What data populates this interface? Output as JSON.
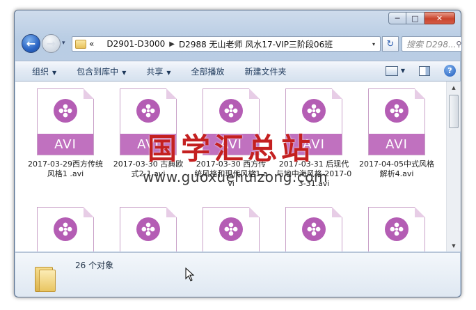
{
  "titlebar": {
    "minimize_glyph": "─",
    "maximize_glyph": "□",
    "close_glyph": "✕"
  },
  "nav": {
    "back_glyph": "←",
    "forward_glyph": "→",
    "history_glyph": "▾"
  },
  "address": {
    "overflow": "«",
    "crumbs": [
      "D2901-D3000",
      "D2988 无山老师 风水17-VIP三阶段06班"
    ],
    "separator": "▶",
    "dropdown_glyph": "▾",
    "refresh_glyph": "↻"
  },
  "search": {
    "placeholder": "搜索 D298...",
    "icon_glyph": "⚲"
  },
  "toolbar": {
    "organize": "组织",
    "include_in_library": "包含到库中",
    "share": "共享",
    "play_all": "全部播放",
    "new_folder": "新建文件夹",
    "dropdown_arrow": "▼",
    "help_glyph": "?"
  },
  "files": [
    {
      "type_label": "AVI",
      "name": "2017-03-29西方传统风格1 .avi"
    },
    {
      "type_label": "AVI",
      "name": "2017-03-30  古典欧式2-1.avi"
    },
    {
      "type_label": "AVI",
      "name": "2017-03-30  西方传统风格和现代风格1.avi"
    },
    {
      "type_label": "AVI",
      "name": "2017-03-31  后现代与地中海风格 2017-03-31.avi"
    },
    {
      "type_label": "AVI",
      "name": "2017-04-05中式风格解析4.avi"
    },
    {
      "type_label": "",
      "name": ""
    },
    {
      "type_label": "",
      "name": ""
    },
    {
      "type_label": "",
      "name": ""
    },
    {
      "type_label": "",
      "name": ""
    },
    {
      "type_label": "",
      "name": ""
    }
  ],
  "scrollbar": {
    "up_glyph": "▲",
    "down_glyph": "▼"
  },
  "watermark": {
    "title": "国学汇总站",
    "url": "www.guoxuehuizong.com"
  },
  "details": {
    "count_text": "26 个对象"
  }
}
